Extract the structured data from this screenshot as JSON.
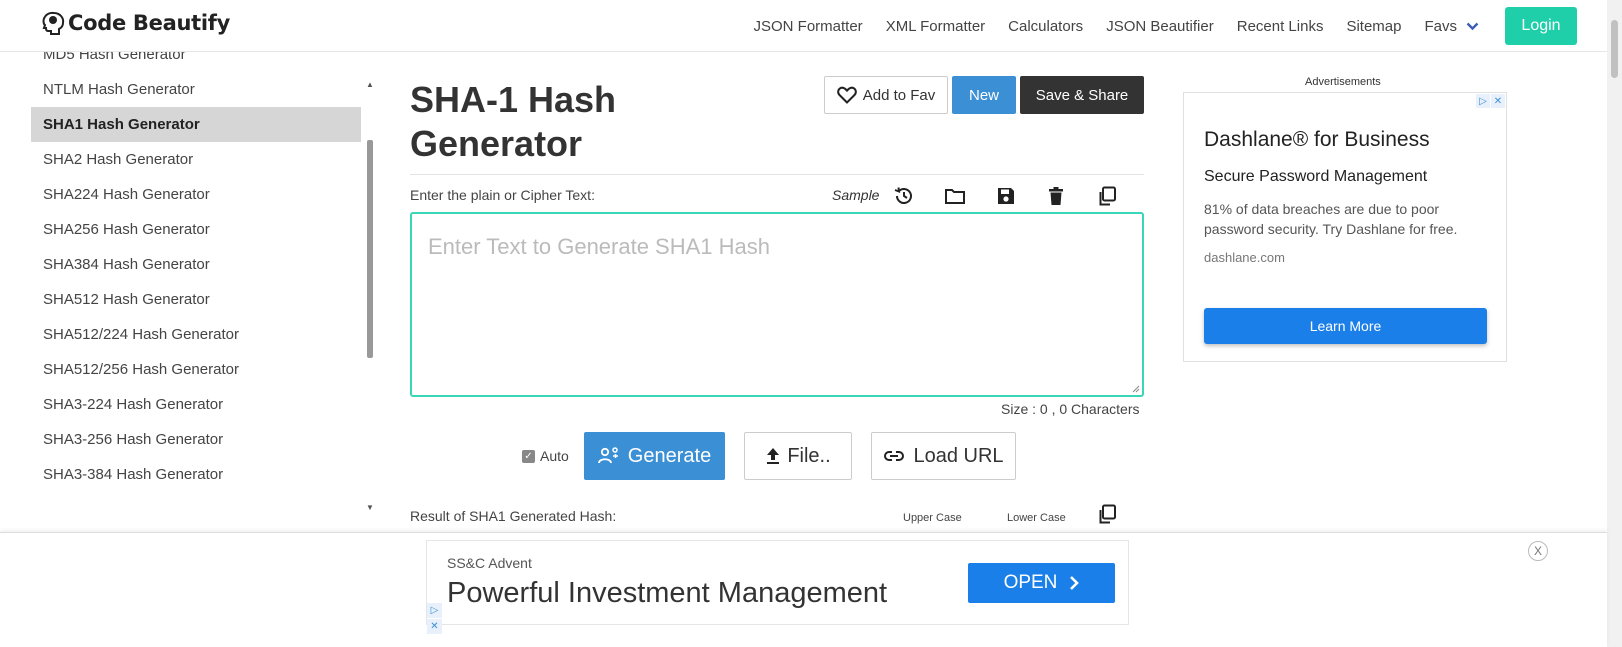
{
  "header": {
    "logo_text": "Code Beautify",
    "nav": [
      "JSON Formatter",
      "XML Formatter",
      "Calculators",
      "JSON Beautifier",
      "Recent Links",
      "Sitemap"
    ],
    "favs_label": "Favs",
    "login_label": "Login"
  },
  "sidebar": {
    "partial_item": "MD5 Hash Generator",
    "items": [
      {
        "label": "NTLM Hash Generator",
        "active": false
      },
      {
        "label": "SHA1 Hash Generator",
        "active": true
      },
      {
        "label": "SHA2 Hash Generator",
        "active": false
      },
      {
        "label": "SHA224 Hash Generator",
        "active": false
      },
      {
        "label": "SHA256 Hash Generator",
        "active": false
      },
      {
        "label": "SHA384 Hash Generator",
        "active": false
      },
      {
        "label": "SHA512 Hash Generator",
        "active": false
      },
      {
        "label": "SHA512/224 Hash Generator",
        "active": false
      },
      {
        "label": "SHA512/256 Hash Generator",
        "active": false
      },
      {
        "label": "SHA3-224 Hash Generator",
        "active": false
      },
      {
        "label": "SHA3-256 Hash Generator",
        "active": false
      },
      {
        "label": "SHA3-384 Hash Generator",
        "active": false
      }
    ]
  },
  "main": {
    "title": "SHA-1 Hash Generator",
    "add_fav_label": "Add to Fav",
    "new_label": "New",
    "save_share_label": "Save & Share",
    "input_label": "Enter the plain or Cipher Text:",
    "sample_label": "Sample",
    "textarea_placeholder": "Enter Text to Generate SHA1 Hash",
    "size_info": "Size : 0 , 0 Characters",
    "auto_label": "Auto",
    "generate_label": "Generate",
    "file_label": "File..",
    "load_url_label": "Load URL",
    "result_label": "Result of SHA1 Generated Hash:",
    "upper_case_label": "Upper Case",
    "lower_case_label": "Lower Case"
  },
  "right_ad": {
    "label": "Advertisements",
    "title": "Dashlane® for Business",
    "subtitle": "Secure Password Management",
    "description": "81% of data breaches are due to poor password security. Try Dashlane for free.",
    "domain": "dashlane.com",
    "button_label": "Learn More"
  },
  "bottom_ad": {
    "brand": "SS&C Advent",
    "title": "Powerful Investment Management",
    "button_label": "OPEN",
    "close_label": "X"
  },
  "colors": {
    "accent_teal": "#1fcfa9",
    "primary_blue": "#3b8fd5",
    "ad_blue": "#1a7fe8",
    "dark_button": "#333333"
  }
}
